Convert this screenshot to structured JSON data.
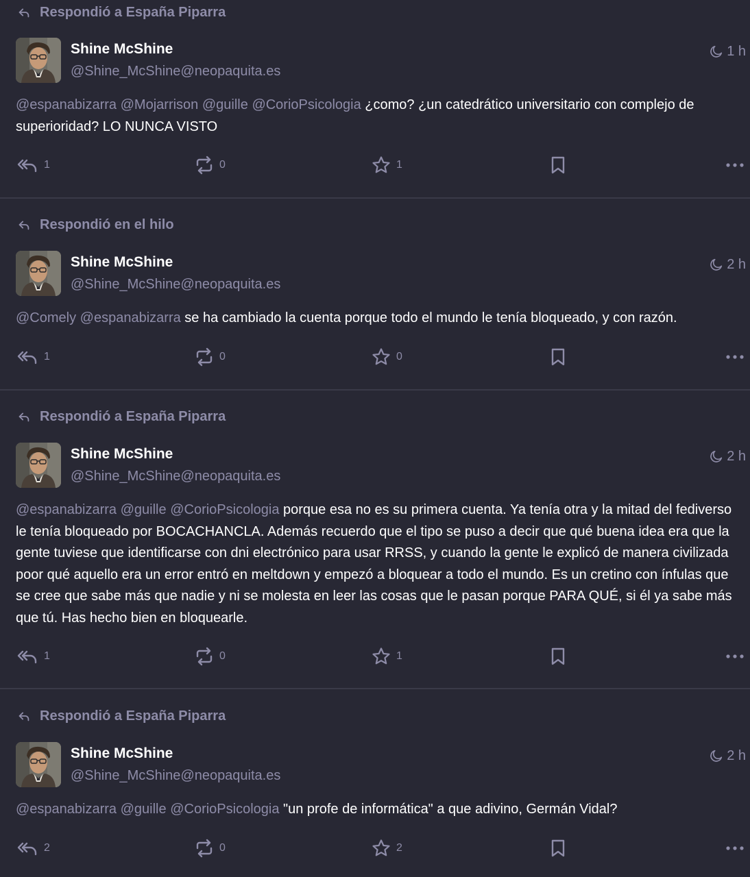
{
  "colors": {
    "background": "#282834",
    "divider": "#3a3a48",
    "muted": "#8e8ca8",
    "text": "#ffffff"
  },
  "icons": {
    "reply_indicator": "reply-arrow-icon",
    "visibility": "moon-icon",
    "reply_all": "reply-all-icon",
    "boost": "boost-icon",
    "favourite": "star-icon",
    "bookmark": "bookmark-icon",
    "more": "more-icon"
  },
  "posts": [
    {
      "reply_label": "Respondió a España Piparra",
      "author_name": "Shine McShine",
      "author_handle": "@Shine_McShine@neopaquita.es",
      "time": "1 h",
      "content": [
        {
          "t": "@espanabizarra",
          "m": true
        },
        {
          "t": " ",
          "m": false
        },
        {
          "t": "@Mojarrison",
          "m": true
        },
        {
          "t": " ",
          "m": false
        },
        {
          "t": "@guille",
          "m": true
        },
        {
          "t": " ",
          "m": false
        },
        {
          "t": "@CorioPsicologia",
          "m": true
        },
        {
          "t": " ¿como? ¿un catedrático universitario con complejo de superioridad? LO NUNCA VISTO",
          "m": false
        }
      ],
      "replies": "1",
      "boosts": "0",
      "favourites": "1"
    },
    {
      "reply_label": "Respondió en el hilo",
      "author_name": "Shine McShine",
      "author_handle": "@Shine_McShine@neopaquita.es",
      "time": "2 h",
      "content": [
        {
          "t": "@Comely",
          "m": true
        },
        {
          "t": " ",
          "m": false
        },
        {
          "t": "@espanabizarra",
          "m": true
        },
        {
          "t": " se ha cambiado la cuenta porque todo el mundo le tenía bloqueado, y con razón.",
          "m": false
        }
      ],
      "replies": "1",
      "boosts": "0",
      "favourites": "0"
    },
    {
      "reply_label": "Respondió a España Piparra",
      "author_name": "Shine McShine",
      "author_handle": "@Shine_McShine@neopaquita.es",
      "time": "2 h",
      "content": [
        {
          "t": "@espanabizarra",
          "m": true
        },
        {
          "t": " ",
          "m": false
        },
        {
          "t": "@guille",
          "m": true
        },
        {
          "t": " ",
          "m": false
        },
        {
          "t": "@CorioPsicologia",
          "m": true
        },
        {
          "t": " porque esa no es su primera cuenta. Ya tenía otra y la mitad del fediverso le tenía bloqueado por BOCACHANCLA. Además recuerdo que el tipo se puso a decir que qué buena idea era que la gente tuviese que identificarse con dni electrónico para usar RRSS, y cuando la gente le explicó de manera civilizada poor qué aquello era un error entró en meltdown y empezó a bloquear a todo el mundo. Es un cretino con ínfulas que se cree que sabe más que nadie y ni se molesta en leer las cosas que le pasan porque PARA QUÉ, si él ya sabe más que tú. Has hecho bien en bloquearle.",
          "m": false
        }
      ],
      "replies": "1",
      "boosts": "0",
      "favourites": "1"
    },
    {
      "reply_label": "Respondió a España Piparra",
      "author_name": "Shine McShine",
      "author_handle": "@Shine_McShine@neopaquita.es",
      "time": "2 h",
      "content": [
        {
          "t": "@espanabizarra",
          "m": true
        },
        {
          "t": " ",
          "m": false
        },
        {
          "t": "@guille",
          "m": true
        },
        {
          "t": " ",
          "m": false
        },
        {
          "t": "@CorioPsicologia",
          "m": true
        },
        {
          "t": " \"un profe de informática\" a que adivino, Germán Vidal?",
          "m": false
        }
      ],
      "replies": "2",
      "boosts": "0",
      "favourites": "2"
    }
  ]
}
